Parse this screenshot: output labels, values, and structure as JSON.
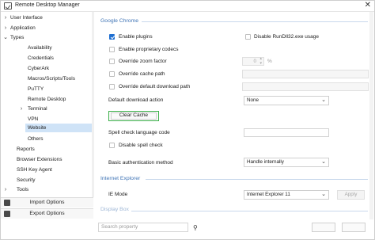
{
  "window": {
    "title": "Remote Desktop Manager",
    "close_glyph": "✕"
  },
  "sidebar": {
    "items": [
      {
        "label": "User Interface",
        "expander": "›"
      },
      {
        "label": "Application",
        "expander": "›"
      },
      {
        "label": "Types",
        "expander": "⌄"
      },
      {
        "label": "Availability",
        "expander": ""
      },
      {
        "label": "Credentials",
        "expander": ""
      },
      {
        "label": "CyberArk",
        "expander": ""
      },
      {
        "label": "Macros/Scripts/Tools",
        "expander": ""
      },
      {
        "label": "PuTTY",
        "expander": ""
      },
      {
        "label": "Remote Desktop",
        "expander": ""
      },
      {
        "label": "Terminal",
        "expander": "›"
      },
      {
        "label": "VPN",
        "expander": ""
      },
      {
        "label": "Website",
        "expander": ""
      },
      {
        "label": "Others",
        "expander": ""
      },
      {
        "label": "Reports",
        "expander": ""
      },
      {
        "label": "Browser Extensions",
        "expander": ""
      },
      {
        "label": "SSH Key Agent",
        "expander": ""
      },
      {
        "label": "Security",
        "expander": ""
      },
      {
        "label": "Tools",
        "expander": "›"
      }
    ],
    "selected": "Website",
    "import_label": "Import Options",
    "export_label": "Export Options"
  },
  "search": {
    "placeholder": "Search property",
    "icon": "binoculars-icon"
  },
  "sections": {
    "chrome": "Google Chrome",
    "ie": "Internet Explorer",
    "third": "Display Box"
  },
  "chrome": {
    "enable_plugins": {
      "label": "Enable plugins",
      "checked": true
    },
    "disable_rundll": {
      "label": "Disable RunDll32.exe usage",
      "checked": false
    },
    "proprietary_codecs": {
      "label": "Enable proprietary codecs",
      "checked": false
    },
    "override_zoom": {
      "label": "Override zoom factor",
      "checked": false,
      "value": "0",
      "unit": "%"
    },
    "override_cache": {
      "label": "Override cache path",
      "checked": false
    },
    "override_download": {
      "label": "Override default download path",
      "checked": false
    },
    "default_download_action": {
      "label": "Default download action",
      "value": "None"
    },
    "clear_cache": "Clear Cache",
    "spell_lang": {
      "label": "Spell check language code",
      "value": ""
    },
    "disable_spell": {
      "label": "Disable spell check",
      "checked": false
    },
    "basic_auth": {
      "label": "Basic authentication method",
      "value": "Handle internally"
    }
  },
  "ie": {
    "mode": {
      "label": "IE Mode",
      "value": "Internet Explorer 11"
    },
    "apply": "Apply"
  },
  "colors": {
    "accent": "#3e73b5",
    "selected": "#cfe3f7",
    "highlight": "#3cb04a",
    "check": "#1f6fd1"
  }
}
